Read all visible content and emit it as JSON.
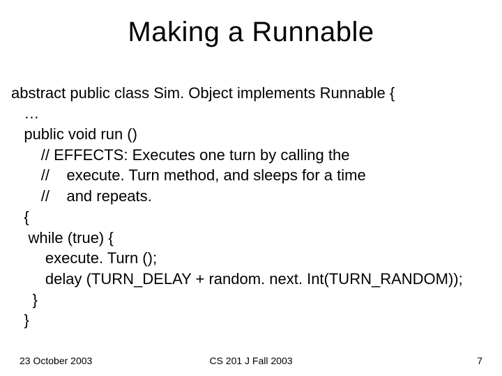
{
  "title": "Making a Runnable",
  "code": {
    "l1": "abstract public class Sim. Object implements Runnable {",
    "l2": "   …",
    "l3": "   public void run ()",
    "l4": "       // EFFECTS: Executes one turn by calling the",
    "l5": "       //    execute. Turn method, and sleeps for a time",
    "l6": "       //    and repeats.",
    "l7": "   {",
    "l8": "    while (true) {",
    "l9": "        execute. Turn ();",
    "l10": "        delay (TURN_DELAY + random. next. Int(TURN_RANDOM));",
    "l11": "     }",
    "l12": "   }"
  },
  "footer": {
    "left": "23 October 2003",
    "center": "CS 201 J Fall 2003",
    "right": "7"
  }
}
